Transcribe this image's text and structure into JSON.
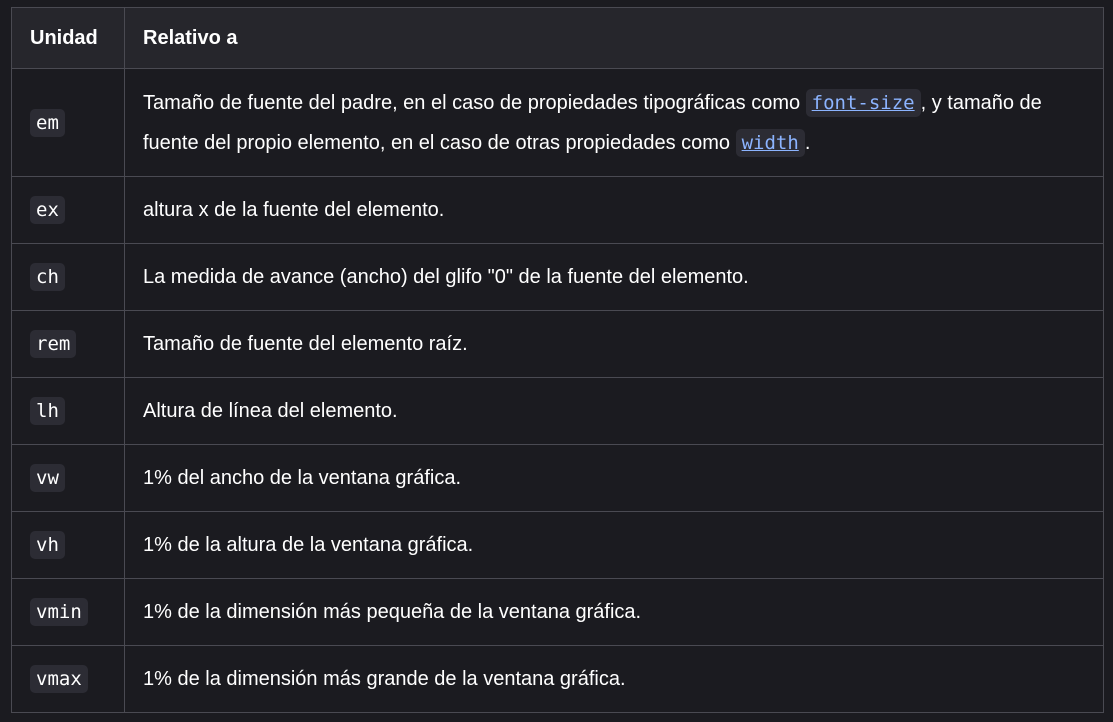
{
  "table": {
    "headers": [
      "Unidad",
      "Relativo a"
    ],
    "rows": [
      {
        "unit": "em",
        "desc_parts": [
          "Tamaño de fuente del padre, en el caso de propiedades tipográficas como ",
          "font-size",
          ", y tamaño de fuente del propio elemento, en el caso de otras propiedades como ",
          "width",
          "."
        ]
      },
      {
        "unit": "ex",
        "desc": "altura x de la fuente del elemento."
      },
      {
        "unit": "ch",
        "desc": "La medida de avance (ancho) del glifo \"0\" de la fuente del elemento."
      },
      {
        "unit": "rem",
        "desc": "Tamaño de fuente del elemento raíz."
      },
      {
        "unit": "lh",
        "desc": "Altura de línea del elemento."
      },
      {
        "unit": "vw",
        "desc": "1% del ancho de la ventana gráfica."
      },
      {
        "unit": "vh",
        "desc": "1% de la altura de la ventana gráfica."
      },
      {
        "unit": "vmin",
        "desc": "1% de la dimensión más pequeña de la ventana gráfica."
      },
      {
        "unit": "vmax",
        "desc": "1% de la dimensión más grande de la ventana gráfica."
      }
    ]
  },
  "colors": {
    "background": "#1b1b20",
    "header_bg": "#26262c",
    "border": "#4a4a52",
    "code_bg": "#2c2c34",
    "link": "#8cb4ff"
  }
}
